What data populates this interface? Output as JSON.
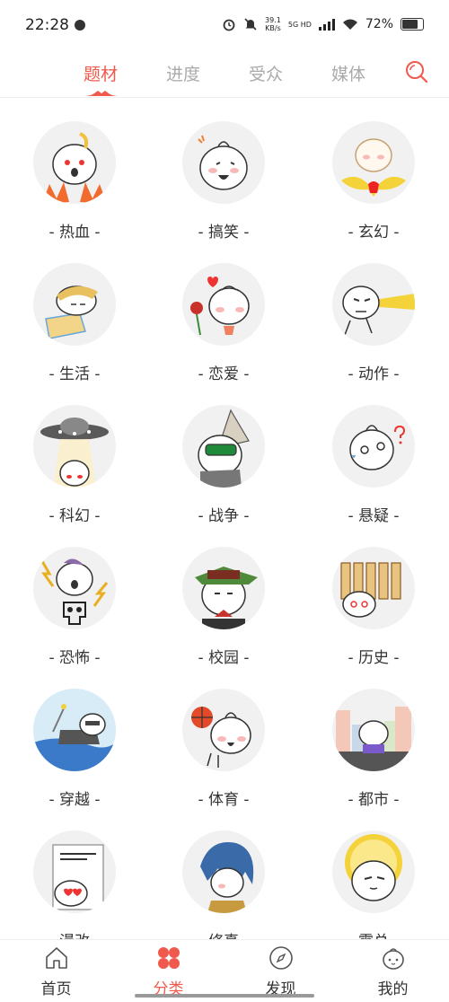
{
  "status_bar": {
    "time": "22:28",
    "speed_value": "39.1",
    "speed_unit": "KB/s",
    "net_label": "5G HD",
    "battery": "72%"
  },
  "tabs": [
    "题材",
    "进度",
    "受众",
    "媒体"
  ],
  "active_tab": "题材",
  "categories": [
    "- 热血 -",
    "- 搞笑 -",
    "- 玄幻 -",
    "- 生活 -",
    "- 恋爱 -",
    "- 动作 -",
    "- 科幻 -",
    "- 战争 -",
    "- 悬疑 -",
    "- 恐怖 -",
    "- 校园 -",
    "- 历史 -",
    "- 穿越 -",
    "- 体育 -",
    "- 都市 -",
    "- 漫改 -",
    "- 修真 -",
    "- 霸总 -"
  ],
  "bottom_nav": [
    "首页",
    "分类",
    "发现",
    "我的"
  ],
  "active_nav": "分类",
  "colors": {
    "accent": "#f05a4d",
    "circle_bg": "#f1f1f1",
    "text": "#333333"
  }
}
